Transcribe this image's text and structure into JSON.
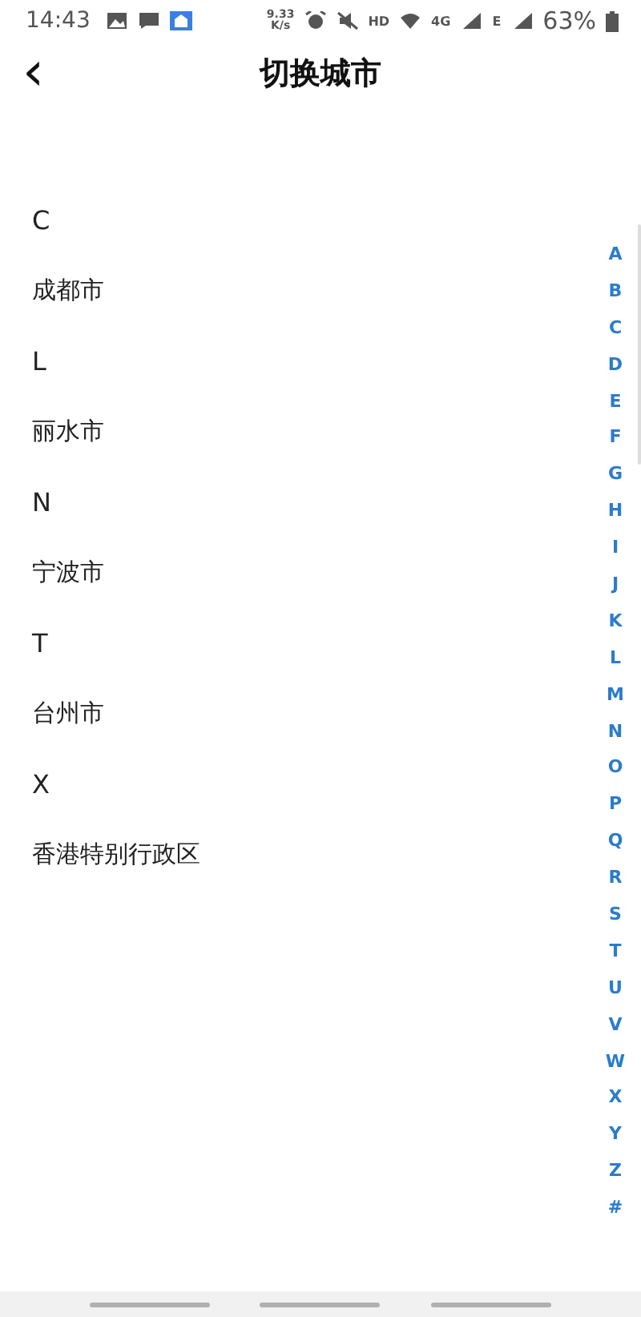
{
  "status_bar": {
    "time": "14:43",
    "net_speed": "9.33\nK/s",
    "hd": "HD",
    "network": "4G",
    "network_2": "E",
    "battery": "63%"
  },
  "header": {
    "back": "‹",
    "title": "切换城市"
  },
  "sections": [
    {
      "letter": "C",
      "cities": [
        "成都市"
      ]
    },
    {
      "letter": "L",
      "cities": [
        "丽水市"
      ]
    },
    {
      "letter": "N",
      "cities": [
        "宁波市"
      ]
    },
    {
      "letter": "T",
      "cities": [
        "台州市"
      ]
    },
    {
      "letter": "X",
      "cities": [
        "香港特别行政区"
      ]
    }
  ],
  "index": [
    "A",
    "B",
    "C",
    "D",
    "E",
    "F",
    "G",
    "H",
    "I",
    "J",
    "K",
    "L",
    "M",
    "N",
    "O",
    "P",
    "Q",
    "R",
    "S",
    "T",
    "U",
    "V",
    "W",
    "X",
    "Y",
    "Z",
    "#"
  ]
}
